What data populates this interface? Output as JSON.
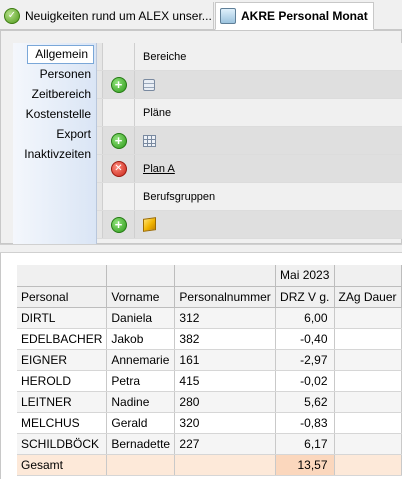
{
  "tabs": [
    {
      "label": "Neuigkeiten rund um ALEX unser...",
      "icon": "info-check-icon"
    },
    {
      "label": "AKRE Personal Monat",
      "icon": "monitor-icon"
    }
  ],
  "nav": {
    "items": [
      "Allgemein",
      "Personen",
      "Zeitbereich",
      "Kostenstelle",
      "Export",
      "Inaktivzeiten"
    ],
    "active": "Allgemein"
  },
  "sections": {
    "bereiche": {
      "title": "Bereiche"
    },
    "plaene": {
      "title": "Pläne",
      "plan": "Plan A"
    },
    "berufsgruppen": {
      "title": "Berufsgruppen"
    }
  },
  "table": {
    "group_header": "Mai 2023",
    "columns": [
      "Personal",
      "Vorname",
      "Personalnummer",
      "DRZ V g.",
      "ZAg Dauer"
    ],
    "rows": [
      {
        "personal": "DIRTL",
        "vorname": "Daniela",
        "nr": "312",
        "drz": "6,00",
        "zag": ""
      },
      {
        "personal": "EDELBACHER",
        "vorname": "Jakob",
        "nr": "382",
        "drz": "-0,40",
        "zag": ""
      },
      {
        "personal": "EIGNER",
        "vorname": "Annemarie",
        "nr": "161",
        "drz": "-2,97",
        "zag": ""
      },
      {
        "personal": "HEROLD",
        "vorname": "Petra",
        "nr": "415",
        "drz": "-0,02",
        "zag": ""
      },
      {
        "personal": "LEITNER",
        "vorname": "Nadine",
        "nr": "280",
        "drz": "5,62",
        "zag": ""
      },
      {
        "personal": "MELCHUS",
        "vorname": "Gerald",
        "nr": "320",
        "drz": "-0,83",
        "zag": ""
      },
      {
        "personal": "SCHILDBÖCK",
        "vorname": "Bernadette",
        "nr": "227",
        "drz": "6,17",
        "zag": ""
      }
    ],
    "total": {
      "label": "Gesamt",
      "drz": "13,57"
    }
  },
  "colors": {
    "total_row": "#fde9d9",
    "nav_active_border": "#7aa7d8",
    "add_green": "#2e9a19",
    "delete_red": "#c72417"
  }
}
